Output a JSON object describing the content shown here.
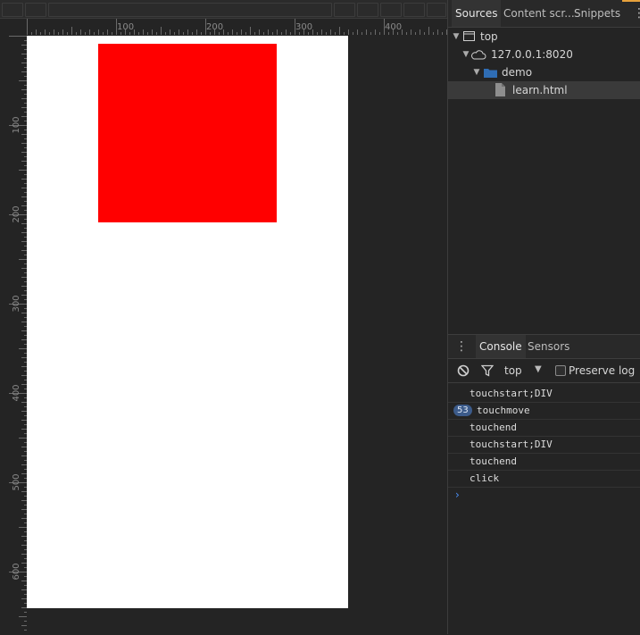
{
  "device": {
    "top_ruler_labels": [
      "100",
      "200",
      "300",
      "400"
    ],
    "left_ruler_labels": [
      "100",
      "200",
      "300",
      "400",
      "500",
      "600"
    ],
    "red_box_color": "#ff0000"
  },
  "sources_panel": {
    "tabs": [
      {
        "label": "Sources",
        "active": true
      },
      {
        "label": "Content scr..."
      },
      {
        "label": "Snippets"
      }
    ],
    "more_icon": "vertical-ellipsis-icon",
    "tree": {
      "top": "top",
      "host": "127.0.0.1:8020",
      "folder": "demo",
      "file": "learn.html"
    }
  },
  "console": {
    "tabs": [
      "Console",
      "Sensors"
    ],
    "context": "top",
    "preserve_log_label": "Preserve log",
    "preserve_log_checked": false,
    "messages": [
      {
        "text": "touchstart;DIV"
      },
      {
        "text": "touchmove",
        "count": "53"
      },
      {
        "text": "touchend"
      },
      {
        "text": "touchstart;DIV"
      },
      {
        "text": "touchend"
      },
      {
        "text": "click"
      }
    ]
  },
  "colors": {
    "badge": "#3c5b8a",
    "folder": "#2f6db4",
    "prompt": "#4a8ff7"
  }
}
